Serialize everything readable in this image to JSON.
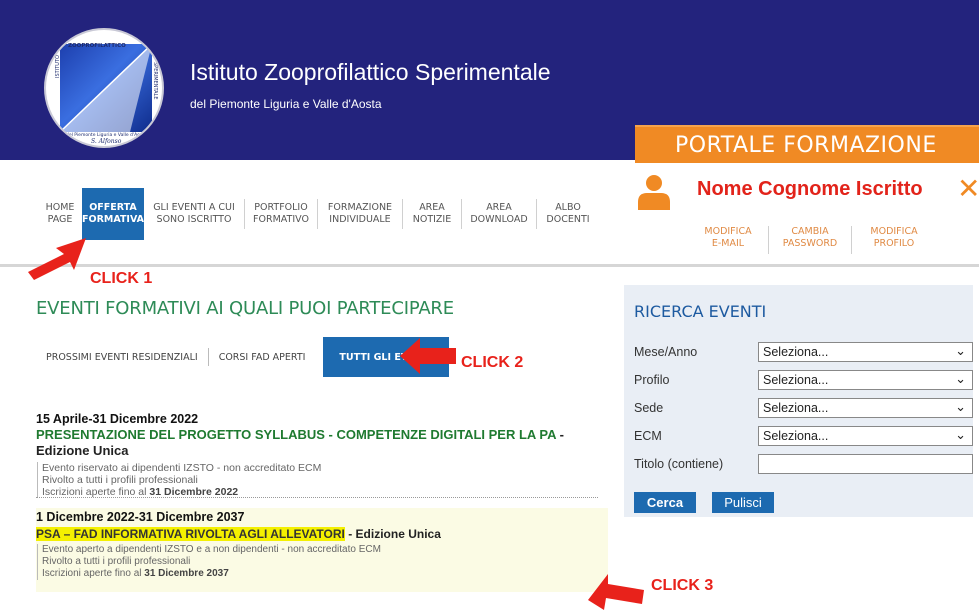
{
  "header": {
    "logo": {
      "top_text": "ZOOPROFILATTICO",
      "left_text": "ISTITUTO",
      "right_text": "SPERIMENTALE",
      "bottom_text": "del Piemonte Liguria e Valle d'Aosta",
      "signature": "S. Alfonso"
    },
    "title": "Istituto Zooprofilattico Sperimentale",
    "subtitle": "del Piemonte Liguria e Valle d'Aosta",
    "portal": "PORTALE FORMAZIONE",
    "colors": {
      "header_bg": "#23237d",
      "portal_bg": "#f08a24"
    }
  },
  "nav": {
    "items": [
      {
        "label": "Home Page",
        "active": false
      },
      {
        "label": "Offerta Formativa",
        "active": true
      },
      {
        "label": "Gli eventi a cui sono iscritto",
        "active": false
      },
      {
        "label": "Portfolio Formativo",
        "active": false
      },
      {
        "label": "Formazione Individuale",
        "active": false
      },
      {
        "label": "Area Notizie",
        "active": false
      },
      {
        "label": "Area Download",
        "active": false
      },
      {
        "label": "Albo Docenti",
        "active": false
      }
    ]
  },
  "user": {
    "name": "Nome Cognome Iscritto",
    "close_icon": "close-icon",
    "actions": [
      {
        "label": "Modifica E-mail"
      },
      {
        "label": "Cambia Password"
      },
      {
        "label": "Modifica Profilo"
      }
    ]
  },
  "content": {
    "section_title": "EVENTI FORMATIVI AI QUALI PUOI PARTECIPARE",
    "tabs": [
      {
        "label": "Prossimi eventi residenziali",
        "active": false
      },
      {
        "label": "Corsi FAD aperti",
        "active": false
      },
      {
        "label": "Tutti gli eventi",
        "active": true
      }
    ],
    "events": [
      {
        "date": "15 Aprile-31 Dicembre 2022",
        "title": "PRESENTAZIONE DEL PROGETTO SYLLABUS - COMPETENZE DIGITALI PER LA PA",
        "edition": " - Edizione Unica",
        "line1": "Evento riservato ai dipendenti IZSTO - non accreditato ECM",
        "line2": "Rivolto a tutti i profili professionali",
        "line3_prefix": "Iscrizioni aperte fino al ",
        "line3_date": "31 Dicembre 2022"
      },
      {
        "date": "1 Dicembre 2022-31 Dicembre 2037",
        "title": "PSA – FAD INFORMATIVA RIVOLTA AGLI ALLEVATORI",
        "edition": " - Edizione Unica",
        "line1": "Evento aperto a dipendenti IZSTO e a non dipendenti - non accreditato ECM",
        "line2": "Rivolto a tutti i profili professionali",
        "line3_prefix": "Iscrizioni aperte fino al ",
        "line3_date": "31 Dicembre 2037"
      }
    ]
  },
  "search": {
    "title": "RICERCA EVENTI",
    "fields": [
      {
        "label": "Mese/Anno",
        "value": "Seleziona..."
      },
      {
        "label": "Profilo",
        "value": "Seleziona..."
      },
      {
        "label": "Sede",
        "value": "Seleziona..."
      },
      {
        "label": "ECM",
        "value": "Seleziona..."
      }
    ],
    "text_field": {
      "label": "Titolo (contiene)",
      "value": ""
    },
    "cerca": "Cerca",
    "pulisci": "Pulisci"
  },
  "annotations": {
    "click1": "CLICK 1",
    "click2": "CLICK 2",
    "click3": "CLICK 3",
    "color": "#e8221b"
  }
}
